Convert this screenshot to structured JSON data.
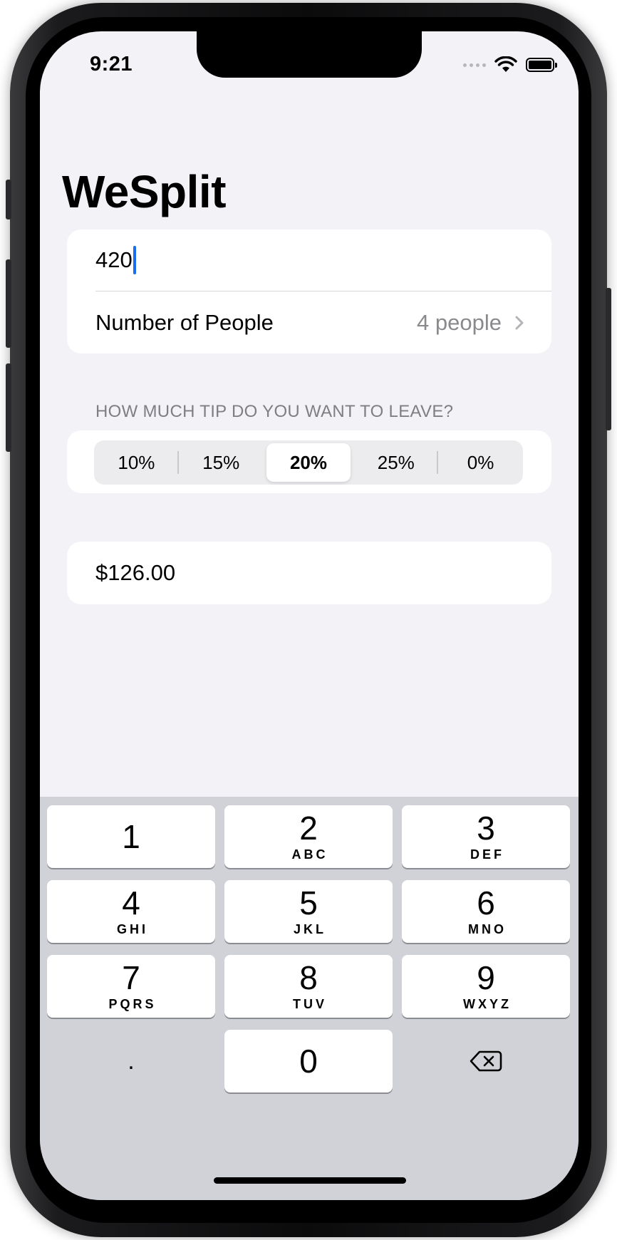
{
  "status_bar": {
    "time": "9:21"
  },
  "app": {
    "title": "WeSplit"
  },
  "form": {
    "amount_value": "420",
    "people_label": "Number of People",
    "people_value": "4 people"
  },
  "tip_section": {
    "header": "HOW MUCH TIP DO YOU WANT TO LEAVE?",
    "options": [
      "10%",
      "15%",
      "20%",
      "25%",
      "0%"
    ],
    "selected": "20%"
  },
  "total": {
    "value": "$126.00"
  },
  "keypad": {
    "keys": [
      {
        "digit": "1",
        "letters": ""
      },
      {
        "digit": "2",
        "letters": "ABC"
      },
      {
        "digit": "3",
        "letters": "DEF"
      },
      {
        "digit": "4",
        "letters": "GHI"
      },
      {
        "digit": "5",
        "letters": "JKL"
      },
      {
        "digit": "6",
        "letters": "MNO"
      },
      {
        "digit": "7",
        "letters": "PQRS"
      },
      {
        "digit": "8",
        "letters": "TUV"
      },
      {
        "digit": "9",
        "letters": "WXYZ"
      },
      {
        "digit": ".",
        "letters": ""
      },
      {
        "digit": "0",
        "letters": ""
      }
    ],
    "delete_icon": "delete-backward-icon"
  },
  "colors": {
    "background": "#f2f2f7",
    "card": "#ffffff",
    "cursor": "#1a6cf0",
    "secondary_text": "#8a8a8e",
    "keyboard_bg": "#d1d2d8"
  }
}
